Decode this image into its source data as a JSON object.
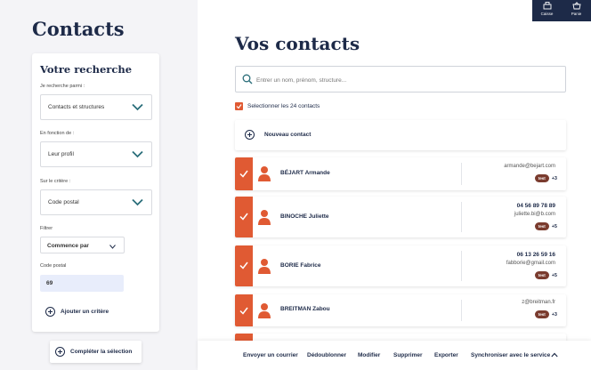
{
  "left": {
    "title": "Contacts",
    "search_title": "Votre recherche",
    "label_parmi": "Je recherche parmi :",
    "select_parmi": "Contacts et structures",
    "label_fonction": "En fonction de :",
    "select_fonction": "Leur profil",
    "label_critere": "Sur le critère :",
    "select_critere": "Code postal",
    "label_filtrer": "Filtrer",
    "select_filtrer": "Commence par",
    "label_cp": "Code postal",
    "cp_value": "69",
    "add_criterion": "Ajouter un critère",
    "complete_selection": "Compléter la sélection"
  },
  "main": {
    "title": "Vos contacts",
    "search_placeholder": "Entrer un nom, prénom, structure...",
    "select_all": "Selectionner les 24 contacts",
    "new_contact": "Nouveau contact"
  },
  "contacts": [
    {
      "name": "BÉJART Armande",
      "phone": "",
      "email": "armande@bejart.com",
      "tag": "test",
      "extra": "+3"
    },
    {
      "name": "BINOCHE Juliette",
      "phone": "04 56 89 78 89",
      "email": "juliette.bi@b.com",
      "tag": "test",
      "extra": "+5"
    },
    {
      "name": "BORIE Fabrice",
      "phone": "06 13 26 59 16",
      "email": "fabborie@gmail.com",
      "tag": "test",
      "extra": "+5"
    },
    {
      "name": "BREITMAN Zabou",
      "phone": "",
      "email": "z@breitman.fr",
      "tag": "test",
      "extra": "+3"
    }
  ],
  "bottom_actions": {
    "send_mail": "Envoyer un courrier",
    "dedupe": "Dédoublonner",
    "modify": "Modifier",
    "delete": "Supprimer",
    "export": "Exporter",
    "sync": "Synchroniser avec le service"
  },
  "top_right": {
    "caisse": "Caisse",
    "panier": "Panie"
  },
  "colors": {
    "accent": "#e05a33",
    "navy": "#1d2a48",
    "tag": "#7a3b2e",
    "teal_chevron": "#2b6e7a"
  }
}
